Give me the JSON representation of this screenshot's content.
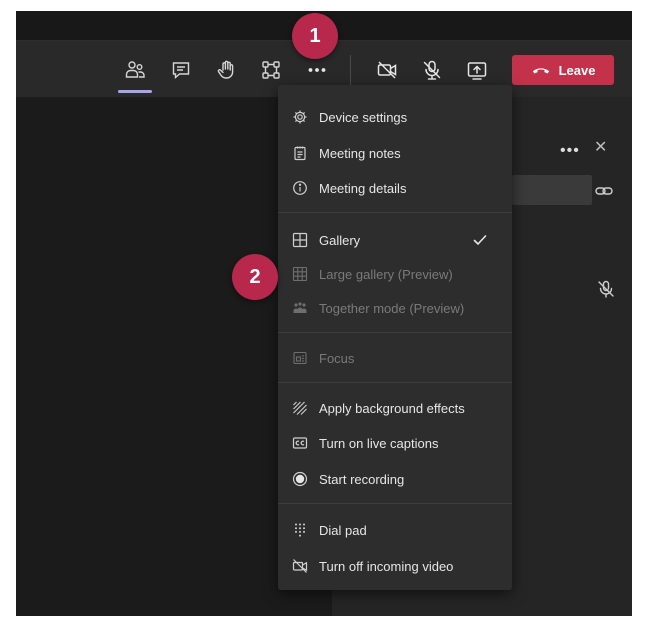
{
  "toolbar": {
    "leave_label": "Leave",
    "leave_color": "#c4314b",
    "icons": [
      "participants-icon",
      "chat-icon",
      "raise-hand-icon",
      "breakout-rooms-icon",
      "more-actions-icon",
      "camera-off-icon",
      "mic-off-icon",
      "share-screen-icon",
      "hang-up-icon"
    ]
  },
  "menu": {
    "items": [
      {
        "label": "Device settings",
        "icon": "gear-icon",
        "disabled": false
      },
      {
        "label": "Meeting notes",
        "icon": "notes-icon",
        "disabled": false
      },
      {
        "label": "Meeting details",
        "icon": "info-icon",
        "disabled": false
      },
      {
        "label": "Gallery",
        "icon": "gallery-icon",
        "disabled": false,
        "checked": true
      },
      {
        "label": "Large gallery (Preview)",
        "icon": "large-gallery-icon",
        "disabled": true
      },
      {
        "label": "Together mode (Preview)",
        "icon": "together-mode-icon",
        "disabled": true
      },
      {
        "label": "Focus",
        "icon": "focus-icon",
        "disabled": true
      },
      {
        "label": "Apply background effects",
        "icon": "background-effects-icon",
        "disabled": false
      },
      {
        "label": "Turn on live captions",
        "icon": "captions-icon",
        "disabled": false
      },
      {
        "label": "Start recording",
        "icon": "record-icon",
        "disabled": false
      },
      {
        "label": "Dial pad",
        "icon": "dial-pad-icon",
        "disabled": false
      },
      {
        "label": "Turn off incoming video",
        "icon": "video-off-icon",
        "disabled": false
      }
    ]
  },
  "callouts": {
    "one": "1",
    "two": "2",
    "color": "#b8274c"
  },
  "accent_color": "#a6a7e8"
}
